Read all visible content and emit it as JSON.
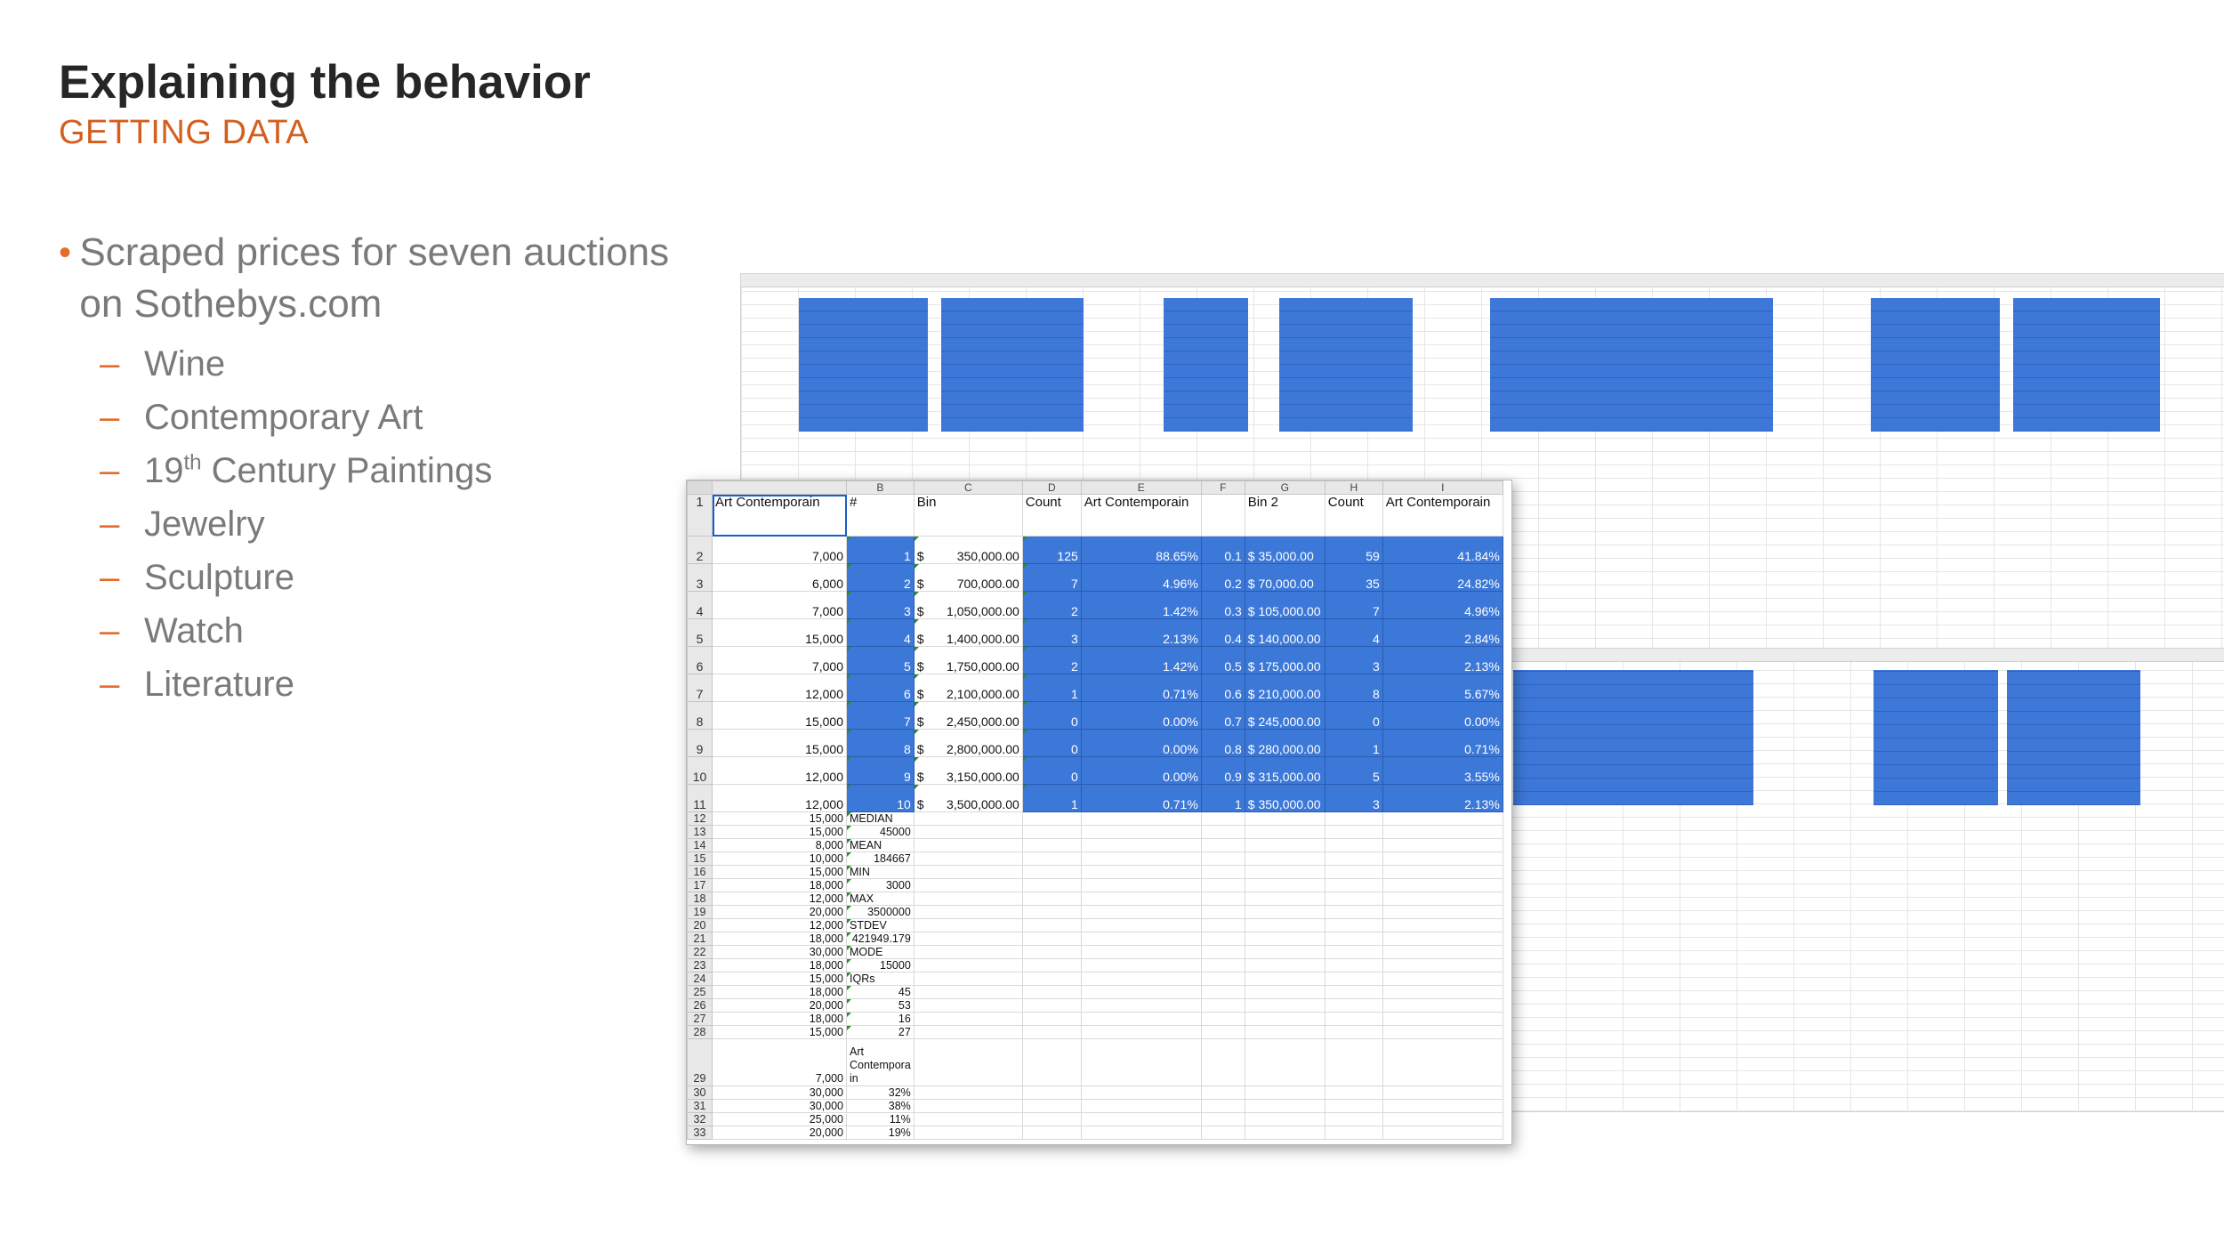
{
  "slide": {
    "title": "Explaining the behavior",
    "subtitle": "GETTING DATA",
    "bullet": "Scraped prices for seven auctions on Sothebys.com",
    "auctions": [
      {
        "text": "Wine"
      },
      {
        "text": "Contemporary Art"
      },
      {
        "base": "19",
        "sup": "th",
        "rest": " Century Paintings"
      },
      {
        "text": "Jewelry"
      },
      {
        "text": "Sculpture"
      },
      {
        "text": "Watch"
      },
      {
        "text": "Literature"
      }
    ]
  },
  "spreadsheet": {
    "columns": [
      "",
      "B",
      "C",
      "D",
      "E",
      "F",
      "G",
      "H",
      "I"
    ],
    "header_row": [
      "Art Contemporain",
      "#",
      "Bin",
      "Count",
      "Art Contemporain",
      "",
      "Bin 2",
      "Count",
      "Art Contemporain"
    ],
    "bin_rows": [
      {
        "row": "2",
        "a": "7,000",
        "n": "1",
        "bin": "350,000.00",
        "count": "125",
        "pct": "88.65%",
        "f": "0.1",
        "bin2": "$ 35,000.00",
        "count2": "59",
        "pct2": "41.84%"
      },
      {
        "row": "3",
        "a": "6,000",
        "n": "2",
        "bin": "700,000.00",
        "count": "7",
        "pct": "4.96%",
        "f": "0.2",
        "bin2": "$ 70,000.00",
        "count2": "35",
        "pct2": "24.82%"
      },
      {
        "row": "4",
        "a": "7,000",
        "n": "3",
        "bin": "1,050,000.00",
        "count": "2",
        "pct": "1.42%",
        "f": "0.3",
        "bin2": "$ 105,000.00",
        "count2": "7",
        "pct2": "4.96%"
      },
      {
        "row": "5",
        "a": "15,000",
        "n": "4",
        "bin": "1,400,000.00",
        "count": "3",
        "pct": "2.13%",
        "f": "0.4",
        "bin2": "$ 140,000.00",
        "count2": "4",
        "pct2": "2.84%"
      },
      {
        "row": "6",
        "a": "7,000",
        "n": "5",
        "bin": "1,750,000.00",
        "count": "2",
        "pct": "1.42%",
        "f": "0.5",
        "bin2": "$ 175,000.00",
        "count2": "3",
        "pct2": "2.13%"
      },
      {
        "row": "7",
        "a": "12,000",
        "n": "6",
        "bin": "2,100,000.00",
        "count": "1",
        "pct": "0.71%",
        "f": "0.6",
        "bin2": "$ 210,000.00",
        "count2": "8",
        "pct2": "5.67%"
      },
      {
        "row": "8",
        "a": "15,000",
        "n": "7",
        "bin": "2,450,000.00",
        "count": "0",
        "pct": "0.00%",
        "f": "0.7",
        "bin2": "$ 245,000.00",
        "count2": "0",
        "pct2": "0.00%"
      },
      {
        "row": "9",
        "a": "15,000",
        "n": "8",
        "bin": "2,800,000.00",
        "count": "0",
        "pct": "0.00%",
        "f": "0.8",
        "bin2": "$ 280,000.00",
        "count2": "1",
        "pct2": "0.71%"
      },
      {
        "row": "10",
        "a": "12,000",
        "n": "9",
        "bin": "3,150,000.00",
        "count": "0",
        "pct": "0.00%",
        "f": "0.9",
        "bin2": "$ 315,000.00",
        "count2": "5",
        "pct2": "3.55%"
      },
      {
        "row": "11",
        "a": "12,000",
        "n": "10",
        "bin": "3,500,000.00",
        "count": "1",
        "pct": "0.71%",
        "f": "1",
        "bin2": "$ 350,000.00",
        "count2": "3",
        "pct2": "2.13%"
      }
    ],
    "stat_rows": [
      {
        "row": "12",
        "a": "15,000",
        "b": "MEDIAN",
        "bnum": false
      },
      {
        "row": "13",
        "a": "15,000",
        "b": "45000",
        "bnum": true
      },
      {
        "row": "14",
        "a": "8,000",
        "b": "MEAN",
        "bnum": false
      },
      {
        "row": "15",
        "a": "10,000",
        "b": "184667",
        "bnum": true
      },
      {
        "row": "16",
        "a": "15,000",
        "b": "MIN",
        "bnum": false
      },
      {
        "row": "17",
        "a": "18,000",
        "b": "3000",
        "bnum": true
      },
      {
        "row": "18",
        "a": "12,000",
        "b": "MAX",
        "bnum": false
      },
      {
        "row": "19",
        "a": "20,000",
        "b": "3500000",
        "bnum": true
      },
      {
        "row": "20",
        "a": "12,000",
        "b": "STDEV",
        "bnum": false
      },
      {
        "row": "21",
        "a": "18,000",
        "b": "421949.179",
        "bnum": true
      },
      {
        "row": "22",
        "a": "30,000",
        "b": "MODE",
        "bnum": false
      },
      {
        "row": "23",
        "a": "18,000",
        "b": "15000",
        "bnum": true
      },
      {
        "row": "24",
        "a": "15,000",
        "b": "IQRs",
        "bnum": false
      },
      {
        "row": "25",
        "a": "18,000",
        "b": "45",
        "bnum": true
      },
      {
        "row": "26",
        "a": "20,000",
        "b": "53",
        "bnum": true
      },
      {
        "row": "27",
        "a": "18,000",
        "b": "16",
        "bnum": true
      },
      {
        "row": "28",
        "a": "15,000",
        "b": "27",
        "bnum": true
      }
    ],
    "tall_row": {
      "row": "29",
      "a": "7,000",
      "b": "Art Contempora in"
    },
    "tail_rows": [
      {
        "row": "30",
        "a": "30,000",
        "b": "32%"
      },
      {
        "row": "31",
        "a": "30,000",
        "b": "38%"
      },
      {
        "row": "32",
        "a": "25,000",
        "b": "11%"
      },
      {
        "row": "33",
        "a": "20,000",
        "b": "19%"
      }
    ]
  }
}
